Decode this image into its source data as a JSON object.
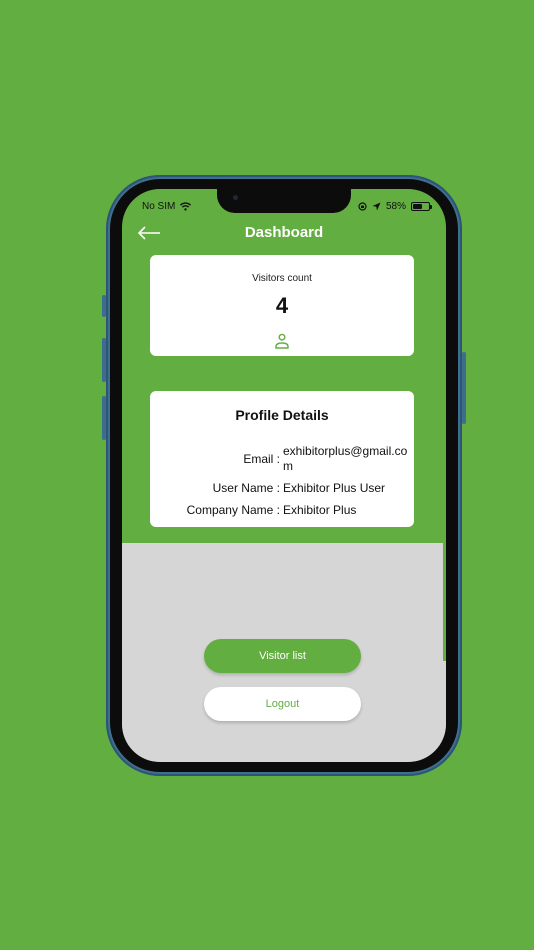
{
  "status_bar": {
    "carrier": "No SIM",
    "battery": "58%",
    "battery_level": 0.58
  },
  "header": {
    "title": "Dashboard"
  },
  "visitors": {
    "label": "Visitors count",
    "count": "4"
  },
  "profile": {
    "title": "Profile Details",
    "email_label": "Email :",
    "email_value": "exhibitorplus@gmail.com",
    "username_label": "User Name :",
    "username_value": "Exhibitor Plus User",
    "company_label": "Company Name :",
    "company_value": "Exhibitor Plus"
  },
  "actions": {
    "visitor_list": "Visitor list",
    "logout": "Logout"
  },
  "colors": {
    "brand_green": "#63ae41",
    "panel_gray": "#d6d6d6"
  },
  "icons": [
    "wifi-icon",
    "location-icon",
    "orientation-lock-icon",
    "battery-icon",
    "back-arrow-icon",
    "person-icon"
  ]
}
